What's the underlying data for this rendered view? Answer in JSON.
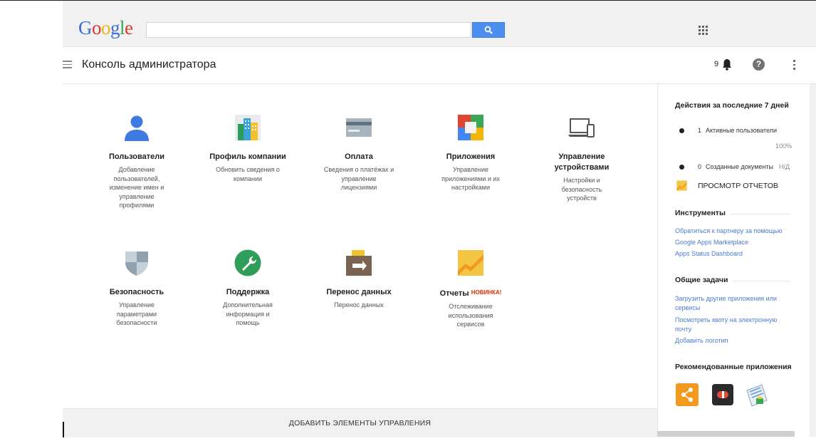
{
  "topbar": {
    "logo_letters": [
      {
        "ch": "G",
        "color": "#3a6fd8"
      },
      {
        "ch": "o",
        "color": "#d93a2b"
      },
      {
        "ch": "o",
        "color": "#efb41c"
      },
      {
        "ch": "g",
        "color": "#3a6fd8"
      },
      {
        "ch": "l",
        "color": "#3aa757"
      },
      {
        "ch": "e",
        "color": "#d93a2b"
      }
    ],
    "search": {
      "value": "",
      "placeholder": ""
    },
    "icons": {
      "search": "search-icon",
      "apps": "apps-grid-icon"
    }
  },
  "header": {
    "title": "Консоль администратора",
    "notification_count": "9",
    "icons": {
      "menu": "hamburger-menu-icon",
      "bell": "bell-icon",
      "help": "help-icon",
      "more": "more-vert-icon"
    },
    "help_glyph": "?"
  },
  "tiles": [
    {
      "title": "Пользователи",
      "desc": "Добавление пользователей, изменение имен и управление профилями",
      "icon": "users-icon"
    },
    {
      "title": "Профиль компании",
      "desc": "Обновить сведения о компании",
      "icon": "company-profile-icon"
    },
    {
      "title": "Оплата",
      "desc": "Сведения о платёжах и управление лицензиями",
      "icon": "billing-card-icon"
    },
    {
      "title": "Приложения",
      "desc": "Управление приложениями и их настройками",
      "icon": "apps-icon"
    },
    {
      "title": "Управление устройствами",
      "desc": "Настройки и безопасность устройств",
      "icon": "devices-icon"
    },
    {
      "title": "Безопасность",
      "desc": "Управление параметрами безопасности",
      "icon": "security-shield-icon"
    },
    {
      "title": "Поддержка",
      "desc": "Дополнительная информация и помощь",
      "icon": "support-wrench-icon"
    },
    {
      "title": "Перенос данных",
      "desc": "Перенос данных",
      "icon": "data-migration-icon"
    },
    {
      "title": "Отчеты",
      "badge": "НОВИНКА!",
      "desc": "Отслеживание использования сервисов",
      "icon": "reports-chart-icon"
    }
  ],
  "sidebar": {
    "activity_title": "Действия за последние 7 дней",
    "stats": [
      {
        "count": "1",
        "label": "Активные пользователи",
        "percent": "100%"
      },
      {
        "count": "0",
        "label": "Созданные документы",
        "percent": "Н/Д"
      }
    ],
    "report_button": "ПРОСМОТР ОТЧЕТОВ",
    "tools_title": "Инструменты",
    "tools_links": [
      "Обратиться к партнеру за помощью",
      "Google Apps Marketplace",
      "Apps Status Dashboard"
    ],
    "tasks_title": "Общие задачи",
    "tasks_links": [
      "Загрузить другие приложения или сервисы",
      "Посмотреть квоту на электронную почту",
      "Добавить логотип"
    ],
    "recommended_title": "Рекомендованные приложения",
    "recommended_apps": [
      {
        "icon": "recommended-app-orange-icon",
        "color": "#f39a1e"
      },
      {
        "icon": "recommended-app-dark-icon",
        "color": "#2b2b2b"
      },
      {
        "icon": "recommended-app-receipt-icon",
        "color": "#6a9bd8"
      }
    ]
  },
  "bottom": {
    "add_controls": "ДОБАВИТЬ ЭЛЕМЕНТЫ УПРАВЛЕНИЯ"
  }
}
